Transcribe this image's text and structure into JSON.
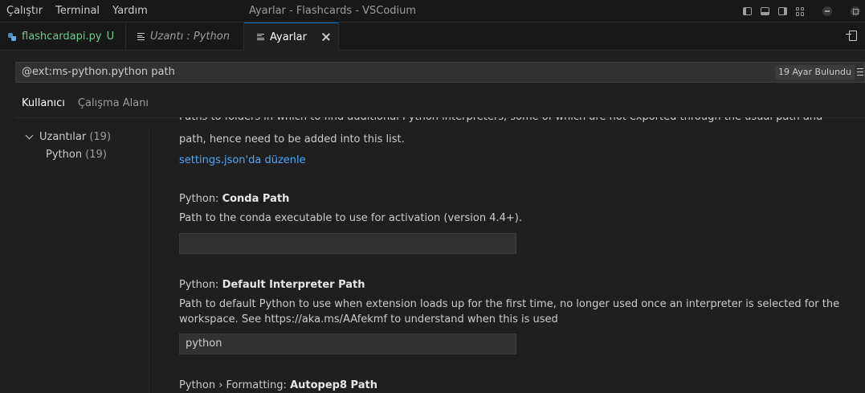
{
  "menu": [
    "Çalıştır",
    "Terminal",
    "Yardım"
  ],
  "window_title": "Ayarlar - Flashcards - VSCodium",
  "tabs": [
    {
      "label": "flashcardapi.py",
      "badge": "U"
    },
    {
      "label": "Uzantı : Python"
    },
    {
      "label": "Ayarlar"
    }
  ],
  "search": {
    "query": "@ext:ms-python.python path",
    "count": "19 Ayar Bulundu"
  },
  "scope_tabs": [
    "Kullanıcı",
    "Çalışma Alanı"
  ],
  "toc": {
    "group": {
      "label": "Uzantılar",
      "count": "(19)"
    },
    "item": {
      "label": "Python",
      "count": "(19)"
    }
  },
  "settings": {
    "prev_desc_cut": "Paths to folders in which to find additional Python interpreters, some of which are not exported through the usual path and environment variables are",
    "prev_desc_tail": "path, hence need to be added into this list.",
    "edit_link": "settings.json'da düzenle",
    "items": [
      {
        "category": "Python: ",
        "name": "Conda Path",
        "desc": "Path to the conda executable to use for activation (version 4.4+).",
        "value": ""
      },
      {
        "category": "Python: ",
        "name": "Default Interpreter Path",
        "desc": "Path to default Python to use when extension loads up for the first time, no longer used once an interpreter is selected for the workspace. See https://aka.ms/AAfekmf to understand when this is used",
        "value": "python"
      },
      {
        "category": "Python › Formatting: ",
        "name": "Autopep8 Path"
      }
    ]
  }
}
